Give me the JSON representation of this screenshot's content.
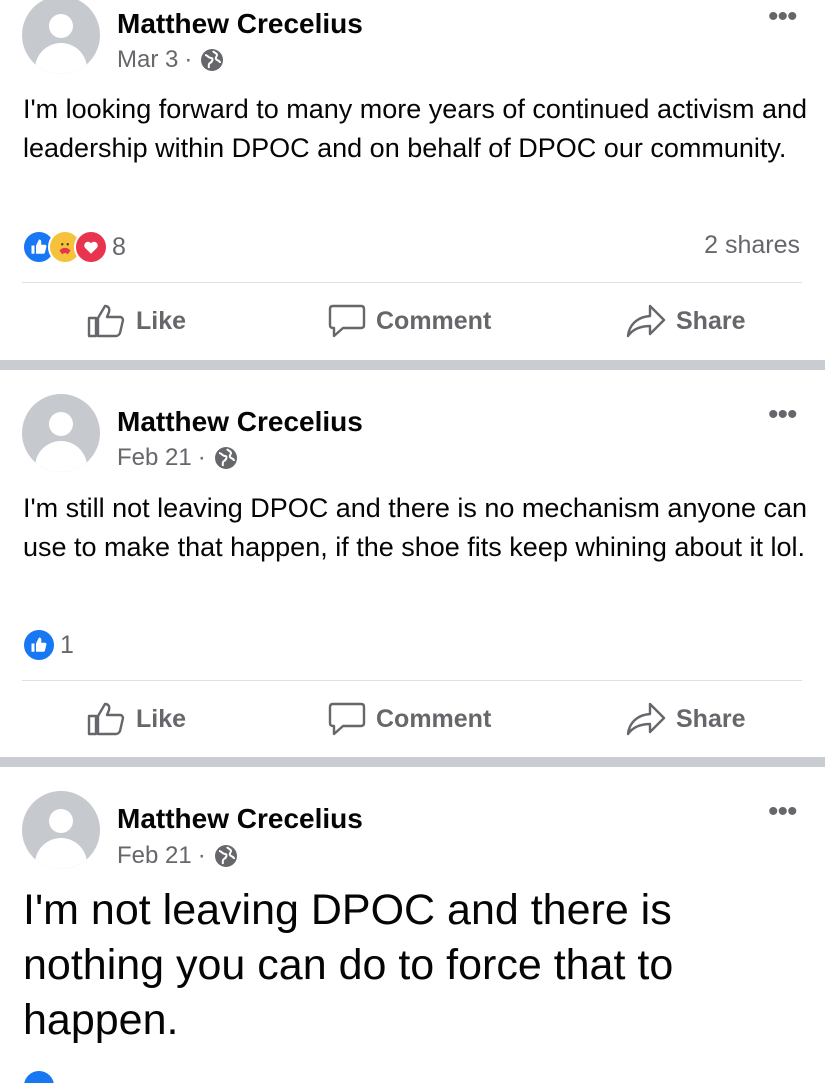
{
  "icons": {
    "more": "more-options-icon",
    "globe": "globe-icon",
    "like": "like-icon",
    "comment": "comment-icon",
    "share": "share-icon"
  },
  "colors": {
    "like_blue": "#1877f2",
    "love_red": "#e8344e",
    "care_yellow": "#f7c23b",
    "secondary_text": "#65676b",
    "separator": "#c9ccd1"
  },
  "actions": {
    "like": "Like",
    "comment": "Comment",
    "share": "Share"
  },
  "posts": [
    {
      "author": "Matthew Crecelius",
      "date": "Mar 3",
      "dot": "·",
      "text": "I'm looking forward to many more years of continued activism and leadership within DPOC and on behalf of DPOC our  community.",
      "reactions": [
        "like",
        "care",
        "love"
      ],
      "reaction_count": "8",
      "shares": "2 shares"
    },
    {
      "author": "Matthew Crecelius",
      "date": "Feb 21",
      "dot": "·",
      "text": "I'm still not leaving DPOC and there is no mechanism anyone can use to make that happen, if the shoe fits keep whining about it lol.",
      "reactions": [
        "like"
      ],
      "reaction_count": "1"
    },
    {
      "author": "Matthew Crecelius",
      "date": "Feb 21",
      "dot": "·",
      "text": "I'm not leaving DPOC and there is nothing you can do to force that to happen."
    }
  ]
}
